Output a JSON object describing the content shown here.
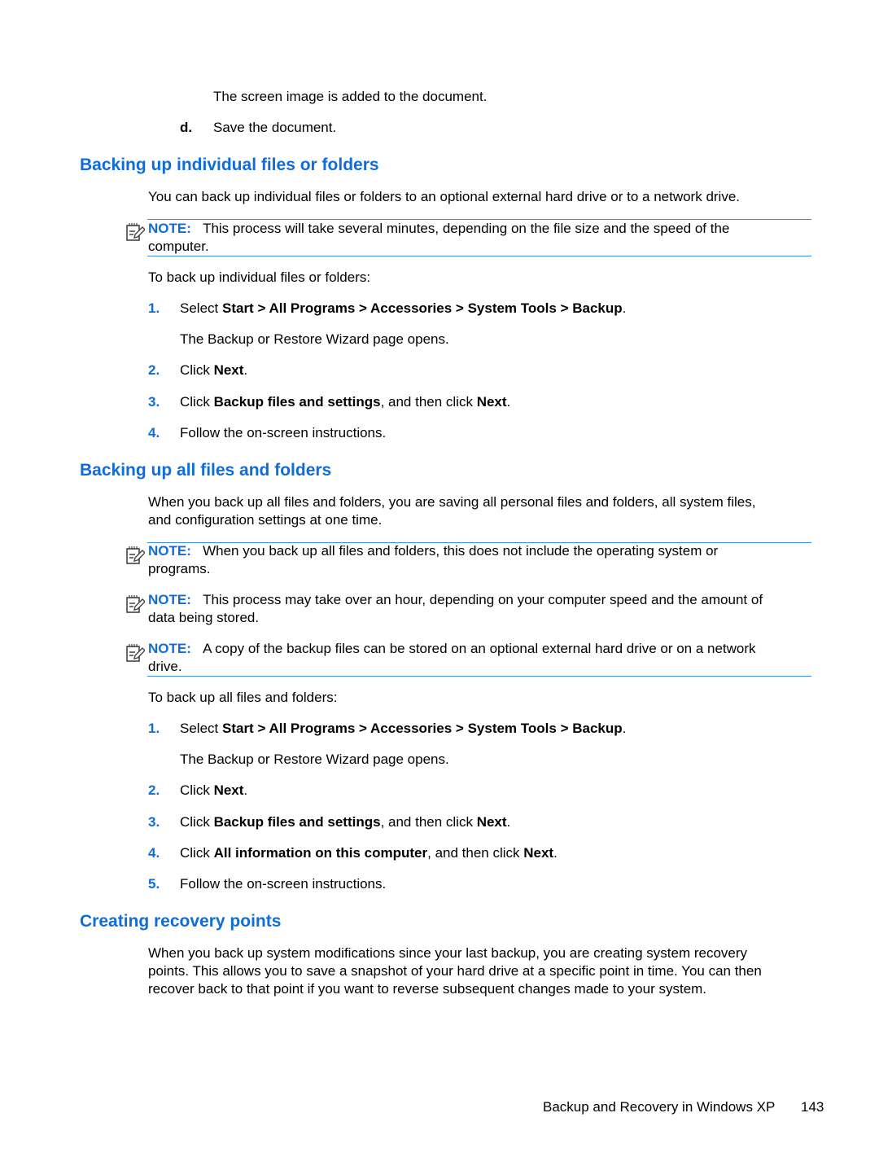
{
  "top": {
    "continuation": "The screen image is added to the document.",
    "step_d_label": "d.",
    "step_d_text": "Save the document."
  },
  "section1": {
    "heading": "Backing up individual files or folders",
    "intro": "You can back up individual files or folders to an optional external hard drive or to a network drive.",
    "note_label": "NOTE:",
    "note_line1": "This process will take several minutes, depending on the file size and the speed of the",
    "note_line2": "computer.",
    "lead": "To back up individual files or folders:",
    "steps": [
      {
        "num": "1.",
        "pre": "Select ",
        "bold": "Start > All Programs > Accessories > System Tools > Backup",
        "post": ".",
        "sub": "The Backup or Restore Wizard page opens."
      },
      {
        "num": "2.",
        "pre": "Click ",
        "bold": "Next",
        "post": "."
      },
      {
        "num": "3.",
        "pre": "Click ",
        "bold": "Backup files and settings",
        "mid": ", and then click ",
        "bold2": "Next",
        "post": "."
      },
      {
        "num": "4.",
        "pre": "Follow the on-screen instructions."
      }
    ]
  },
  "section2": {
    "heading": "Backing up all files and folders",
    "intro_line1": "When you back up all files and folders, you are saving all personal files and folders, all system files,",
    "intro_line2": "and configuration settings at one time.",
    "notes": [
      {
        "label": "NOTE:",
        "line1": "When you back up all files and folders, this does not include the operating system or",
        "line2": "programs."
      },
      {
        "label": "NOTE:",
        "line1": "This process may take over an hour, depending on your computer speed and the amount of",
        "line2": "data being stored."
      },
      {
        "label": "NOTE:",
        "line1": "A copy of the backup files can be stored on an optional external hard drive or on a network",
        "line2": "drive."
      }
    ],
    "lead": "To back up all files and folders:",
    "steps": [
      {
        "num": "1.",
        "pre": "Select ",
        "bold": "Start > All Programs > Accessories > System Tools > Backup",
        "post": ".",
        "sub": "The Backup or Restore Wizard page opens."
      },
      {
        "num": "2.",
        "pre": "Click ",
        "bold": "Next",
        "post": "."
      },
      {
        "num": "3.",
        "pre": "Click ",
        "bold": "Backup files and settings",
        "mid": ", and then click ",
        "bold2": "Next",
        "post": "."
      },
      {
        "num": "4.",
        "pre": "Click ",
        "bold": "All information on this computer",
        "mid": ", and then click ",
        "bold2": "Next",
        "post": "."
      },
      {
        "num": "5.",
        "pre": "Follow the on-screen instructions."
      }
    ]
  },
  "section3": {
    "heading": "Creating recovery points",
    "line1": "When you back up system modifications since your last backup, you are creating system recovery",
    "line2": "points. This allows you to save a snapshot of your hard drive at a specific point in time. You can then",
    "line3": "recover back to that point if you want to reverse subsequent changes made to your system."
  },
  "footer": {
    "chapter": "Backup and Recovery in Windows XP",
    "page_number": "143"
  },
  "colors": {
    "heading": "#0f6cdd",
    "rule": "#3b8be8"
  }
}
